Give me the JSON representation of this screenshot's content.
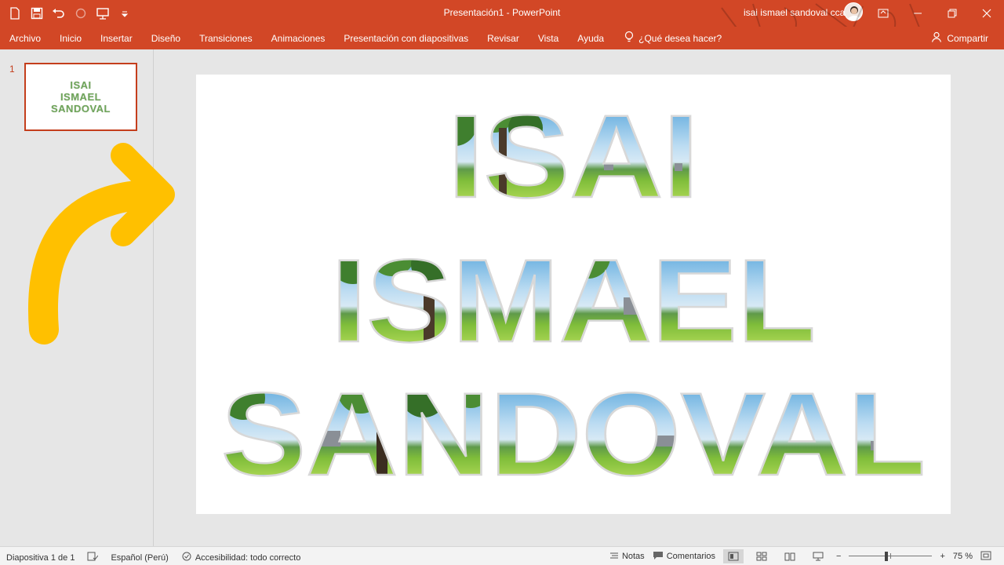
{
  "window": {
    "title": "Presentación1  -  PowerPoint",
    "user": "isai ismael sandoval ccaccro"
  },
  "ribbon": {
    "tabs": [
      "Archivo",
      "Inicio",
      "Insertar",
      "Diseño",
      "Transiciones",
      "Animaciones",
      "Presentación con diapositivas",
      "Revisar",
      "Vista",
      "Ayuda"
    ],
    "search_prompt": "¿Qué desea hacer?",
    "share_label": "Compartir"
  },
  "thumbnails": {
    "slide_number": "1",
    "lines": [
      "ISAI",
      "ISMAEL",
      "SANDOVAL"
    ]
  },
  "slide": {
    "lines": [
      "ISAI",
      "ISMAEL",
      "SANDOVAL"
    ]
  },
  "status": {
    "slide_info": "Diapositiva 1 de 1",
    "language": "Español (Perú)",
    "accessibility": "Accesibilidad: todo correcto",
    "notes": "Notas",
    "comments": "Comentarios",
    "zoom_minus": "−",
    "zoom_plus": "+",
    "zoom": "75 %"
  },
  "colors": {
    "accent": "#d24726",
    "arrow": "#ffc000"
  }
}
